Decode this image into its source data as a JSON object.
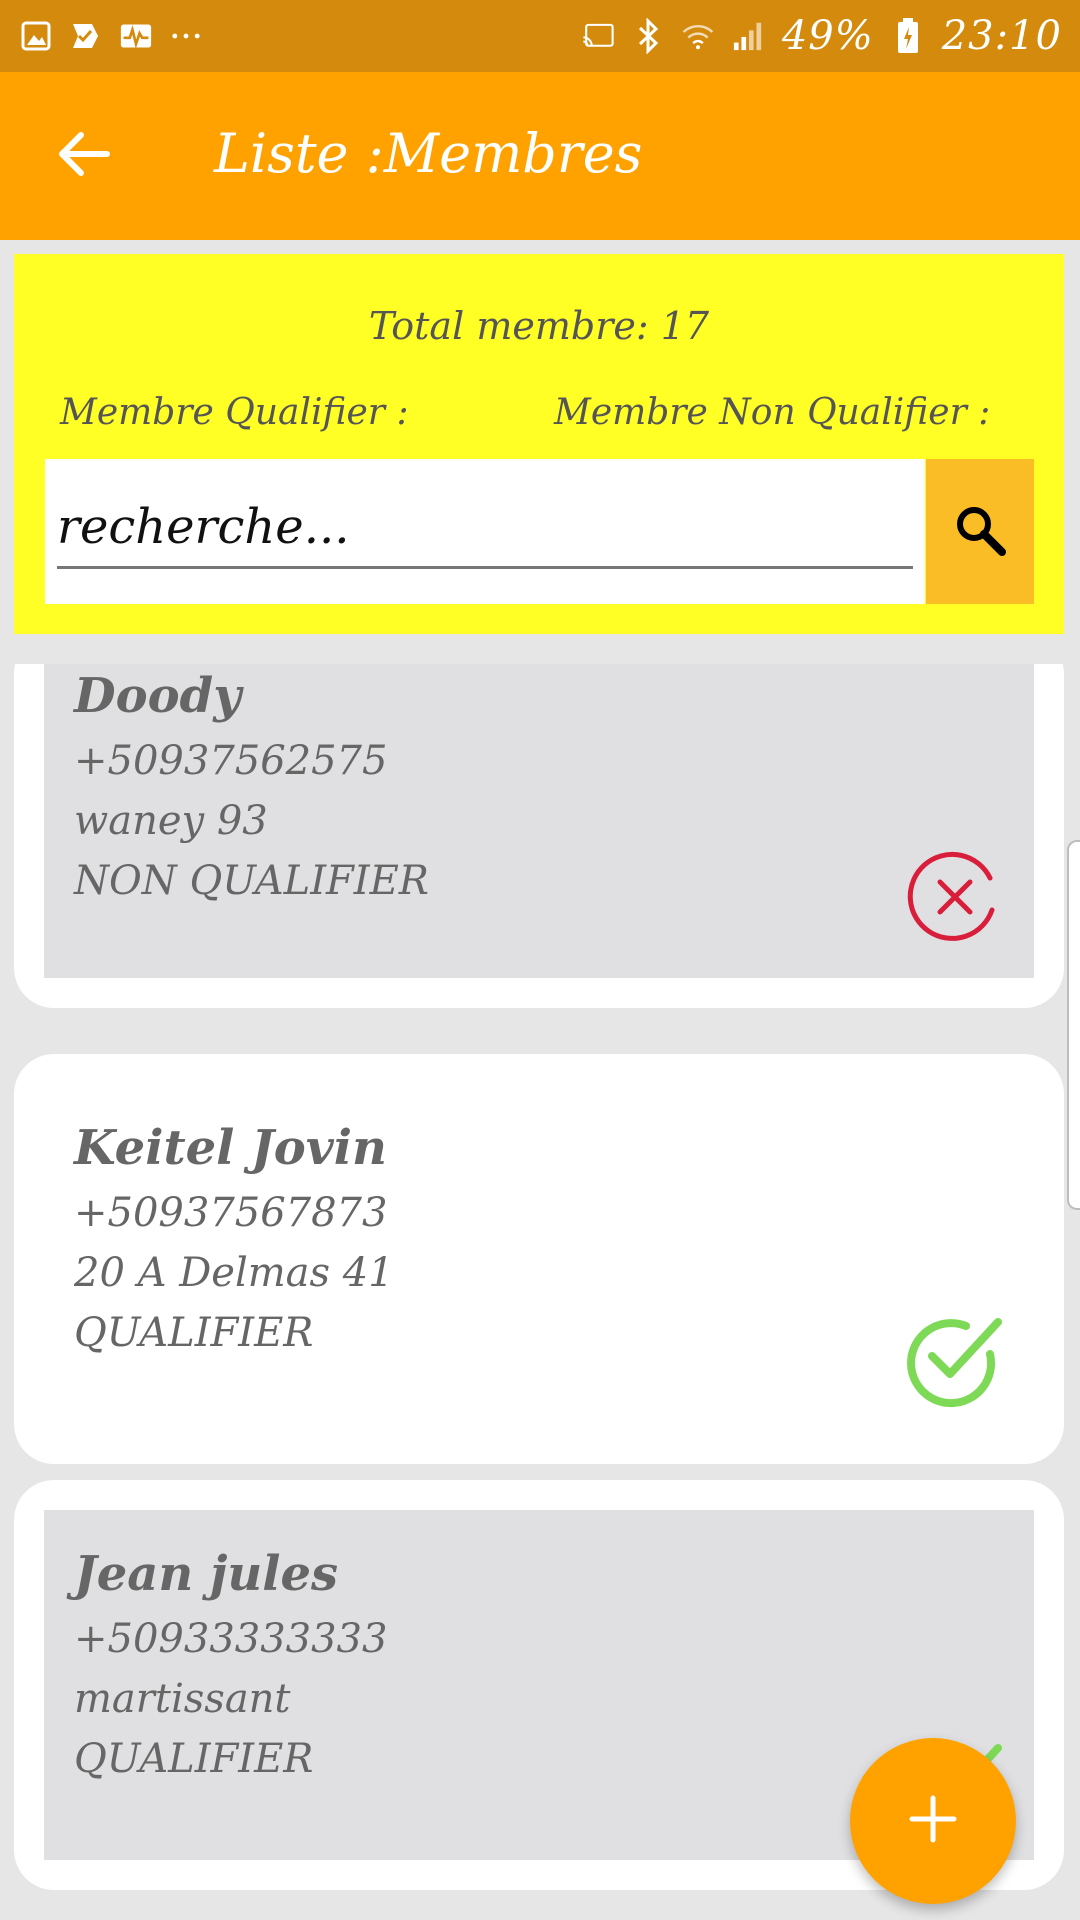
{
  "status_bar": {
    "battery": "49%",
    "time": "23:10",
    "left_icons": [
      "gallery-icon",
      "check-flag-icon",
      "activity-icon",
      "more-dots-icon"
    ],
    "right_icons": [
      "cast-icon",
      "bluetooth-icon",
      "wifi-icon",
      "signal-icon",
      "battery-icon"
    ]
  },
  "app_bar": {
    "title": "Liste :Membres",
    "back_icon": "arrow-left-icon"
  },
  "summary": {
    "total_label": "Total membre: 17",
    "qualified_label": "Membre Qualifier :",
    "non_qualified_label": "Membre Non Qualifier :"
  },
  "search": {
    "placeholder": "recherche...",
    "button_icon": "search-icon"
  },
  "members": [
    {
      "name": "Doody",
      "phone": "+50937562575",
      "address": "waney 93",
      "status": "NON QUALIFIER",
      "status_icon": "cross-circle-icon"
    },
    {
      "name": "Keitel Jovin",
      "phone": "+50937567873",
      "address": "20 A Delmas 41",
      "status": "QUALIFIER",
      "status_icon": "check-circle-icon"
    },
    {
      "name": "Jean jules",
      "phone": "+50933333333",
      "address": "martissant",
      "status": "QUALIFIER",
      "status_icon": "check-circle-icon"
    }
  ],
  "fab": {
    "icon": "plus-icon"
  },
  "colors": {
    "status_bar": "#d38a0d",
    "app_bar": "#ffa200",
    "summary_bg": "#ffff26",
    "search_button": "#fbbd26",
    "qualified": "#7ed957",
    "non_qualified": "#d81e3a"
  }
}
